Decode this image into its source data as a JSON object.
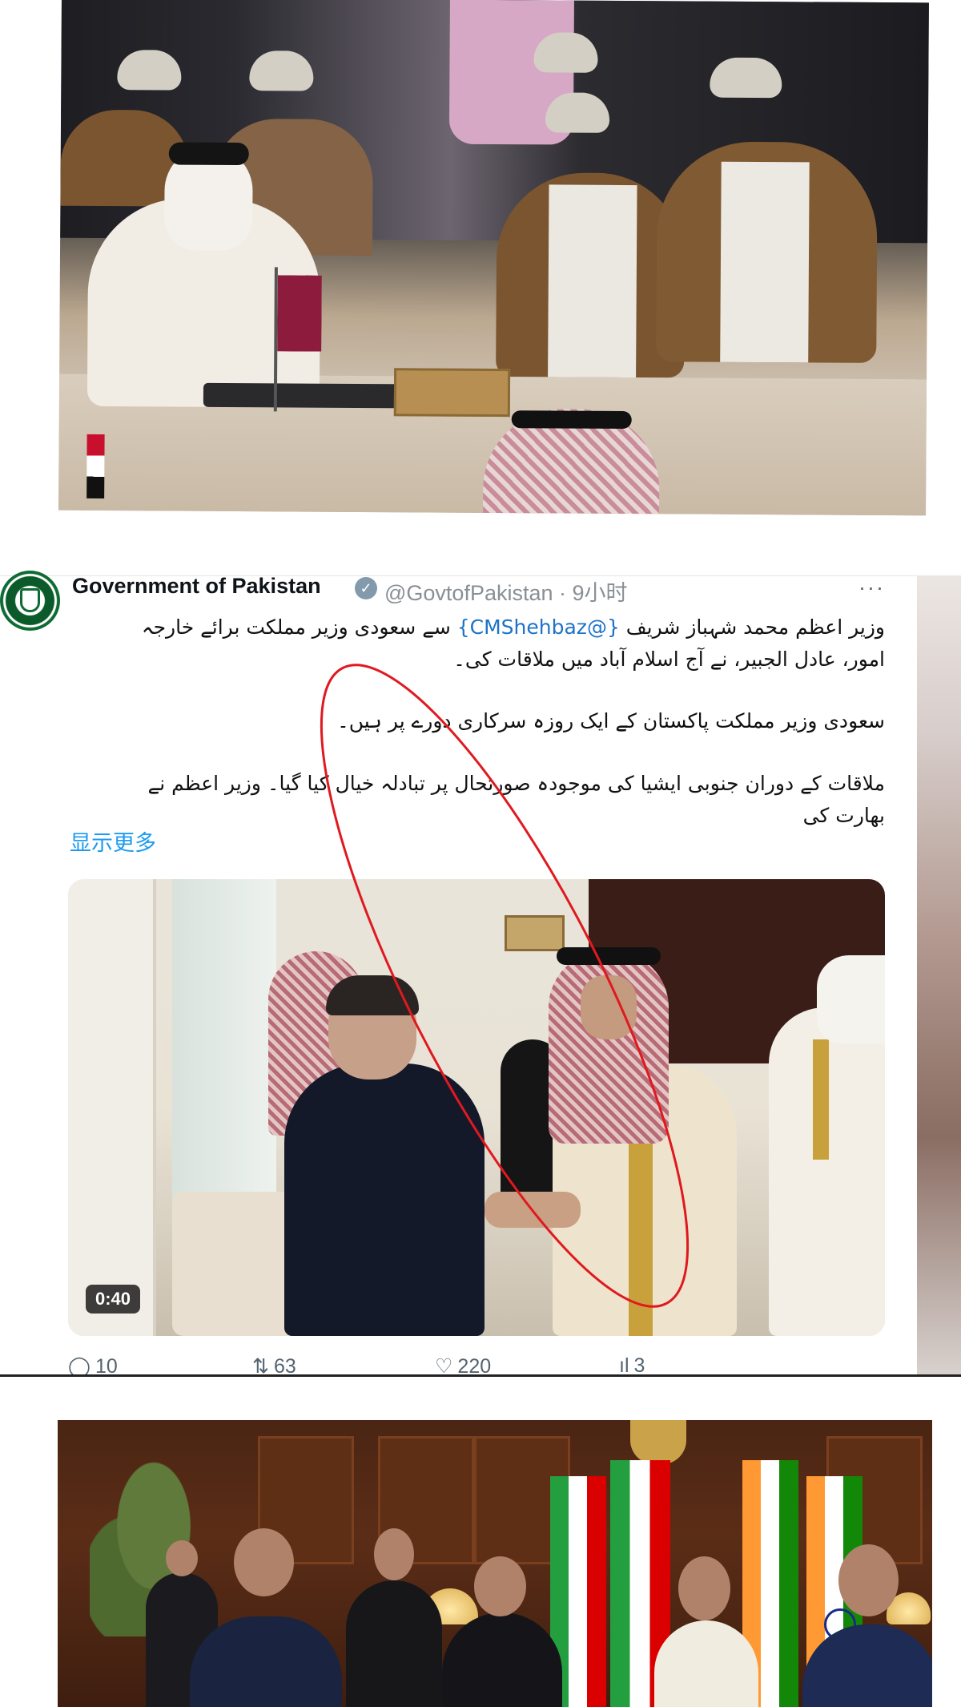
{
  "tweet": {
    "author_name": "Government of Pakistan",
    "verified_symbol": "✓",
    "handle_time": "@GovtofPakistan · 9小时",
    "more_label": "···",
    "body_line1_pre": "وزیر اعظم محمد شہباز شریف ",
    "body_mention": "{@CMShehbaz}",
    "body_line1_post": " سے سعودی وزیر مملکت برائے خارجہ",
    "body_line2": "امور، عادل الجبیر، نے آج اسلام آباد میں ملاقات کی۔",
    "body_para2": "سعودی وزیر مملکت پاکستان کے ایک روزہ سرکاری دورے پر ہیں۔",
    "body_para3_line1": "ملاقات کے دوران جنوبی ایشیا کی موجودہ صورتحال پر تبادلہ خیال کیا گیا۔ وزیر اعظم نے",
    "body_para3_line2": "بھارت کی",
    "show_more": "显示更多",
    "video_duration": "0:40",
    "replies": "10",
    "retweets": "63",
    "likes": "220",
    "views": "3"
  },
  "icons": {
    "reply": "reply-icon",
    "retweet": "retweet-icon",
    "like": "heart-icon",
    "views": "views-icon"
  },
  "colors": {
    "link": "#1d9bf0",
    "annotation": "#e0191f"
  }
}
